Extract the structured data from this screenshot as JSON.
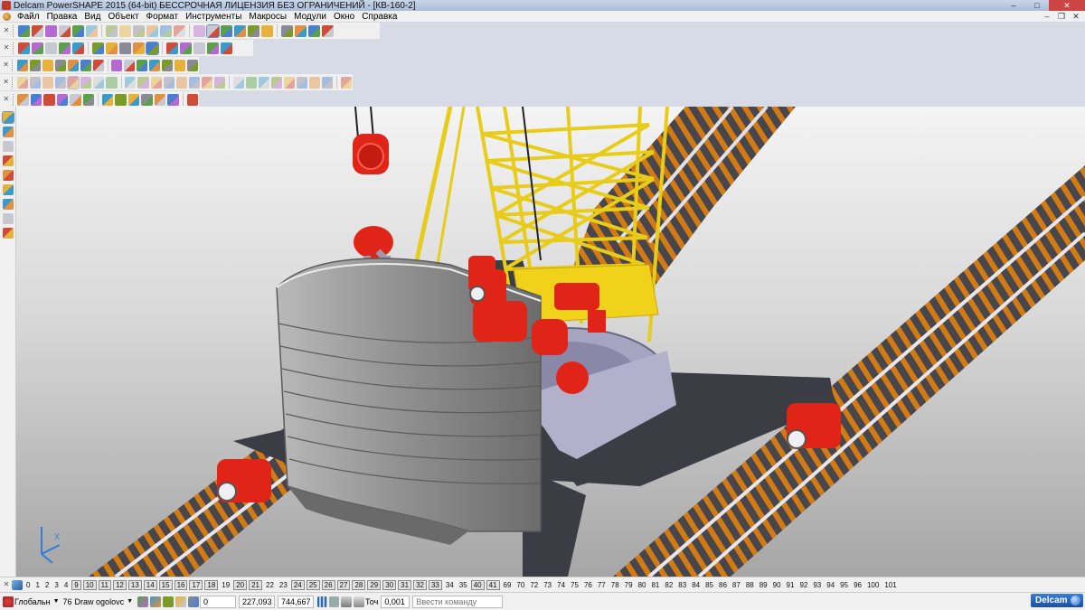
{
  "window": {
    "title": "Delcam PowerSHAPE 2015 (64-bit) БЕССРОЧНАЯ ЛИЦЕНЗИЯ БЕЗ ОГРАНИЧЕНИЙ - [КВ-160-2]",
    "minimize": "‒",
    "maximize": "□",
    "close": "✕"
  },
  "menu": {
    "items": [
      "Файл",
      "Правка",
      "Вид",
      "Объект",
      "Формат",
      "Инструменты",
      "Макросы",
      "Модули",
      "Окно",
      "Справка"
    ],
    "mdi_minimize": "‒",
    "mdi_restore": "❐",
    "mdi_close": "✕"
  },
  "toolbars": {
    "main": [
      "new-file-icon",
      "open-file-icon",
      "save-icon",
      "save-as-icon",
      "print-icon",
      "cut-icon",
      "copy-icon",
      "paste-icon",
      "delete-icon",
      "erase-icon",
      "undo-icon",
      "redo-icon",
      "select-icon",
      "transform-icon",
      "view-icon",
      "circle-icon",
      "arc-icon",
      "curve-icon",
      "surface-icon",
      "solid-icon",
      "mesh-icon",
      "wizard-icon"
    ],
    "view": [
      "iso-view-icon",
      "front-view-icon",
      "top-view-icon",
      "shaded-icon",
      "wireframe-icon",
      "pan-icon",
      "zoom-icon",
      "zoom-box-icon",
      "zoom-fit-icon",
      "globe-icon",
      "render-icon",
      "lighting-icon",
      "material-icon",
      "light-icon",
      "layer-icon"
    ],
    "object": [
      "object-a-icon",
      "object-b-icon",
      "object-c-icon",
      "object-d-icon",
      "sphere-red-icon",
      "sphere-green-icon",
      "arrow-right-icon",
      "arrow-right-2-icon",
      "cube-icon",
      "cube-blue-icon",
      "measure-icon",
      "info-icon",
      "box-icon",
      "move-icon"
    ],
    "feature": [
      "feature-1",
      "feature-2",
      "feature-3",
      "feature-4",
      "feature-5",
      "feature-6",
      "feature-7",
      "feature-8",
      "feature-9",
      "feature-10",
      "feature-11",
      "feature-12",
      "feature-13",
      "feature-14",
      "feature-15",
      "feature-16",
      "feature-17",
      "feature-18",
      "feature-19",
      "feature-20",
      "feature-21",
      "feature-22",
      "feature-23",
      "feature-24",
      "feature-25"
    ],
    "wire": [
      "wire-1",
      "wire-2",
      "wire-3",
      "wire-4",
      "wire-5",
      "wire-6",
      "wire-7",
      "wire-8",
      "wire-9",
      "wire-10",
      "wire-11",
      "wire-12",
      "wire-13"
    ]
  },
  "left_toolbar": [
    "select-arrow-icon",
    "cursor-icon",
    "line-icon",
    "curve-draw-icon",
    "point-icon",
    "arc-draw-icon",
    "dimension-icon",
    "text-icon",
    "axis-icon"
  ],
  "levels": [
    {
      "n": "0",
      "on": false
    },
    {
      "n": "1",
      "on": false
    },
    {
      "n": "2",
      "on": false
    },
    {
      "n": "3",
      "on": false
    },
    {
      "n": "4",
      "on": false
    },
    {
      "n": "9",
      "on": true
    },
    {
      "n": "10",
      "on": true
    },
    {
      "n": "11",
      "on": true
    },
    {
      "n": "12",
      "on": true
    },
    {
      "n": "13",
      "on": true
    },
    {
      "n": "14",
      "on": true
    },
    {
      "n": "15",
      "on": true
    },
    {
      "n": "16",
      "on": true
    },
    {
      "n": "17",
      "on": true
    },
    {
      "n": "18",
      "on": true
    },
    {
      "n": "19",
      "on": false
    },
    {
      "n": "20",
      "on": true
    },
    {
      "n": "21",
      "on": true
    },
    {
      "n": "22",
      "on": false
    },
    {
      "n": "23",
      "on": false
    },
    {
      "n": "24",
      "on": true
    },
    {
      "n": "25",
      "on": true
    },
    {
      "n": "26",
      "on": true
    },
    {
      "n": "27",
      "on": true
    },
    {
      "n": "28",
      "on": true
    },
    {
      "n": "29",
      "on": true
    },
    {
      "n": "30",
      "on": true
    },
    {
      "n": "31",
      "on": true
    },
    {
      "n": "32",
      "on": true
    },
    {
      "n": "33",
      "on": true
    },
    {
      "n": "34",
      "on": false
    },
    {
      "n": "35",
      "on": false
    },
    {
      "n": "40",
      "on": true
    },
    {
      "n": "41",
      "on": true
    },
    {
      "n": "69",
      "on": false
    },
    {
      "n": "70",
      "on": false
    },
    {
      "n": "72",
      "on": false
    },
    {
      "n": "73",
      "on": false
    },
    {
      "n": "74",
      "on": false
    },
    {
      "n": "75",
      "on": false
    },
    {
      "n": "76",
      "on": false
    },
    {
      "n": "77",
      "on": false
    },
    {
      "n": "78",
      "on": false
    },
    {
      "n": "79",
      "on": false
    },
    {
      "n": "80",
      "on": false
    },
    {
      "n": "81",
      "on": false
    },
    {
      "n": "82",
      "on": false
    },
    {
      "n": "83",
      "on": false
    },
    {
      "n": "84",
      "on": false
    },
    {
      "n": "85",
      "on": false
    },
    {
      "n": "86",
      "on": false
    },
    {
      "n": "87",
      "on": false
    },
    {
      "n": "88",
      "on": false
    },
    {
      "n": "89",
      "on": false
    },
    {
      "n": "90",
      "on": false
    },
    {
      "n": "91",
      "on": false
    },
    {
      "n": "92",
      "on": false
    },
    {
      "n": "93",
      "on": false
    },
    {
      "n": "94",
      "on": false
    },
    {
      "n": "95",
      "on": false
    },
    {
      "n": "96",
      "on": false
    },
    {
      "n": "100",
      "on": false
    },
    {
      "n": "101",
      "on": false
    }
  ],
  "status": {
    "workplane": "Глобальн",
    "level_number": "76",
    "level_name": "Draw ogolovc",
    "value_zero": "0",
    "coord_x": "227,093",
    "coord_y": "744,667",
    "tolerance_label": "Точ",
    "tolerance_value": "0,001",
    "command_placeholder": "Ввести команду",
    "brand": "Delcam"
  },
  "viewport": {
    "axis_label": "X"
  },
  "colors": {
    "crane_yellow": "#e8cc1a",
    "mechanism_red": "#e02418",
    "counterweight_gray": "#8e8e8e",
    "rail_orange": "#d27a14",
    "base_dark": "#3c3c44",
    "turntable_lilac": "#a7a4c2"
  }
}
